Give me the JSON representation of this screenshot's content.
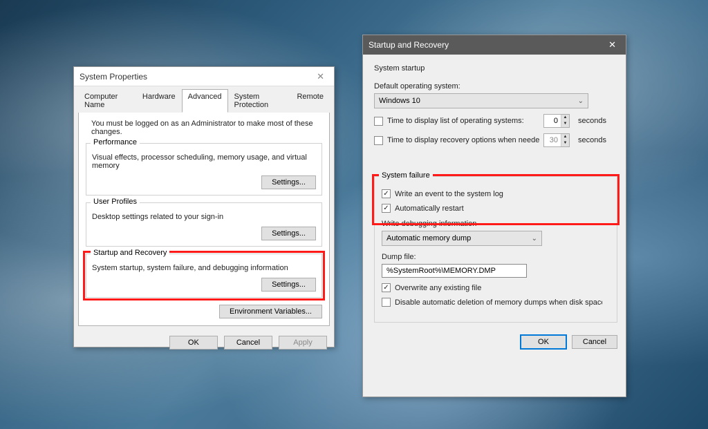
{
  "window1": {
    "title": "System Properties",
    "tabs": [
      "Computer Name",
      "Hardware",
      "Advanced",
      "System Protection",
      "Remote"
    ],
    "active_tab": "Advanced",
    "admin_note": "You must be logged on as an Administrator to make most of these changes.",
    "perf": {
      "title": "Performance",
      "desc": "Visual effects, processor scheduling, memory usage, and virtual memory",
      "settings_btn": "Settings..."
    },
    "profiles": {
      "title": "User Profiles",
      "desc": "Desktop settings related to your sign-in",
      "settings_btn": "Settings..."
    },
    "startup": {
      "title": "Startup and Recovery",
      "desc": "System startup, system failure, and debugging information",
      "settings_btn": "Settings..."
    },
    "env_btn": "Environment Variables...",
    "ok": "OK",
    "cancel": "Cancel",
    "apply": "Apply"
  },
  "window2": {
    "title": "Startup and Recovery",
    "startup_section": "System startup",
    "default_os_label": "Default operating system:",
    "default_os_value": "Windows 10",
    "time_list_label": "Time to display list of operating systems:",
    "time_list_value": "0",
    "time_recovery_label": "Time to display recovery options when needed:",
    "time_recovery_value": "30",
    "seconds": "seconds",
    "failure_section": "System failure",
    "write_event": "Write an event to the system log",
    "auto_restart": "Automatically restart",
    "write_dbg_label": "Write debugging information",
    "write_dbg_value": "Automatic memory dump",
    "dump_file_label": "Dump file:",
    "dump_file_value": "%SystemRoot%\\MEMORY.DMP",
    "overwrite": "Overwrite any existing file",
    "disable_delete": "Disable automatic deletion of memory dumps when disk space is low",
    "ok": "OK",
    "cancel": "Cancel"
  }
}
